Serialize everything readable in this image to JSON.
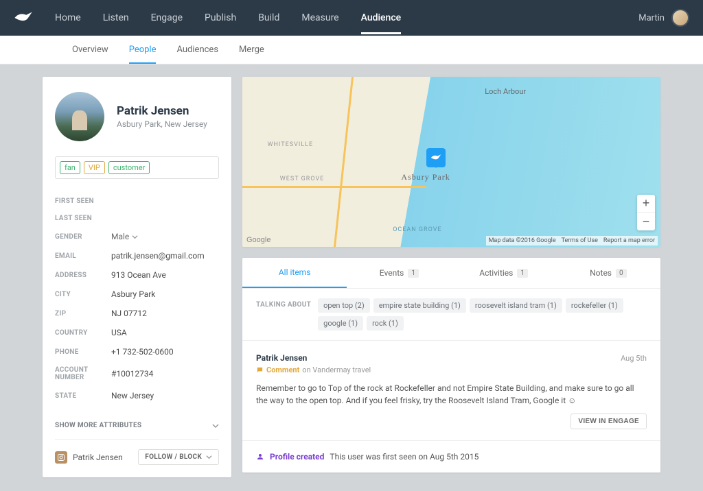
{
  "topnav": {
    "links": [
      "Home",
      "Listen",
      "Engage",
      "Publish",
      "Build",
      "Measure",
      "Audience"
    ],
    "active": "Audience",
    "user": "Martin"
  },
  "subnav": {
    "items": [
      "Overview",
      "People",
      "Audiences",
      "Merge"
    ],
    "active": "People"
  },
  "profile": {
    "name": "Patrik Jensen",
    "location": "Asbury Park, New Jersey",
    "tags": [
      "fan",
      "VIP",
      "customer"
    ]
  },
  "attrs": {
    "first_seen_label": "FIRST SEEN",
    "last_seen_label": "LAST SEEN",
    "gender_label": "GENDER",
    "gender_value": "Male",
    "email_label": "EMAIL",
    "email_value": "patrik.jensen@gmail.com",
    "address_label": "ADDRESS",
    "address_value": "913 Ocean Ave",
    "city_label": "CITY",
    "city_value": "Asbury Park",
    "zip_label": "ZIP",
    "zip_value": "NJ 07712",
    "country_label": "COUNTRY",
    "country_value": "USA",
    "phone_label": "PHONE",
    "phone_value": "+1 732-502-0600",
    "account_label": "ACCOUNT NUMBER",
    "account_value": "#10012734",
    "state_label": "STATE",
    "state_value": "New Jersey",
    "showmore": "SHOW MORE ATTRIBUTES"
  },
  "follow": {
    "name": "Patrik Jensen",
    "button": "FOLLOW / BLOCK"
  },
  "map": {
    "place": "Asbury Park",
    "place2": "Loch Arbour",
    "place3": "WHITESVILLE",
    "place4": "WEST GROVE",
    "place5": "OCEAN GROVE",
    "google": "Google",
    "attrib1": "Map data ©2016 Google",
    "attrib2": "Terms of Use",
    "attrib3": "Report a map error"
  },
  "tabs": {
    "all": "All items",
    "events": "Events",
    "events_count": "1",
    "activities": "Activities",
    "activities_count": "1",
    "notes": "Notes",
    "notes_count": "0"
  },
  "talking": {
    "label": "TALKING ABOUT",
    "tags": [
      "open top (2)",
      "empire state building (1)",
      "roosevelt island tram (1)",
      "rockefeller (1)",
      "google (1)",
      "rock (1)"
    ]
  },
  "feed": {
    "name": "Patrik Jensen",
    "date": "Aug 5th",
    "type_label": "Comment",
    "on_text": "on Vandermay travel",
    "body": "Remember to go to Top of the rock at Rockefeller and not Empire State Building, and make sure to go all the way to the open top. And if you feel frisky, try the Roosevelt Island Tram, Google it ☺",
    "view_button": "VIEW IN ENGAGE"
  },
  "created": {
    "label": "Profile created",
    "text": "This user was first seen on Aug 5th 2015"
  }
}
